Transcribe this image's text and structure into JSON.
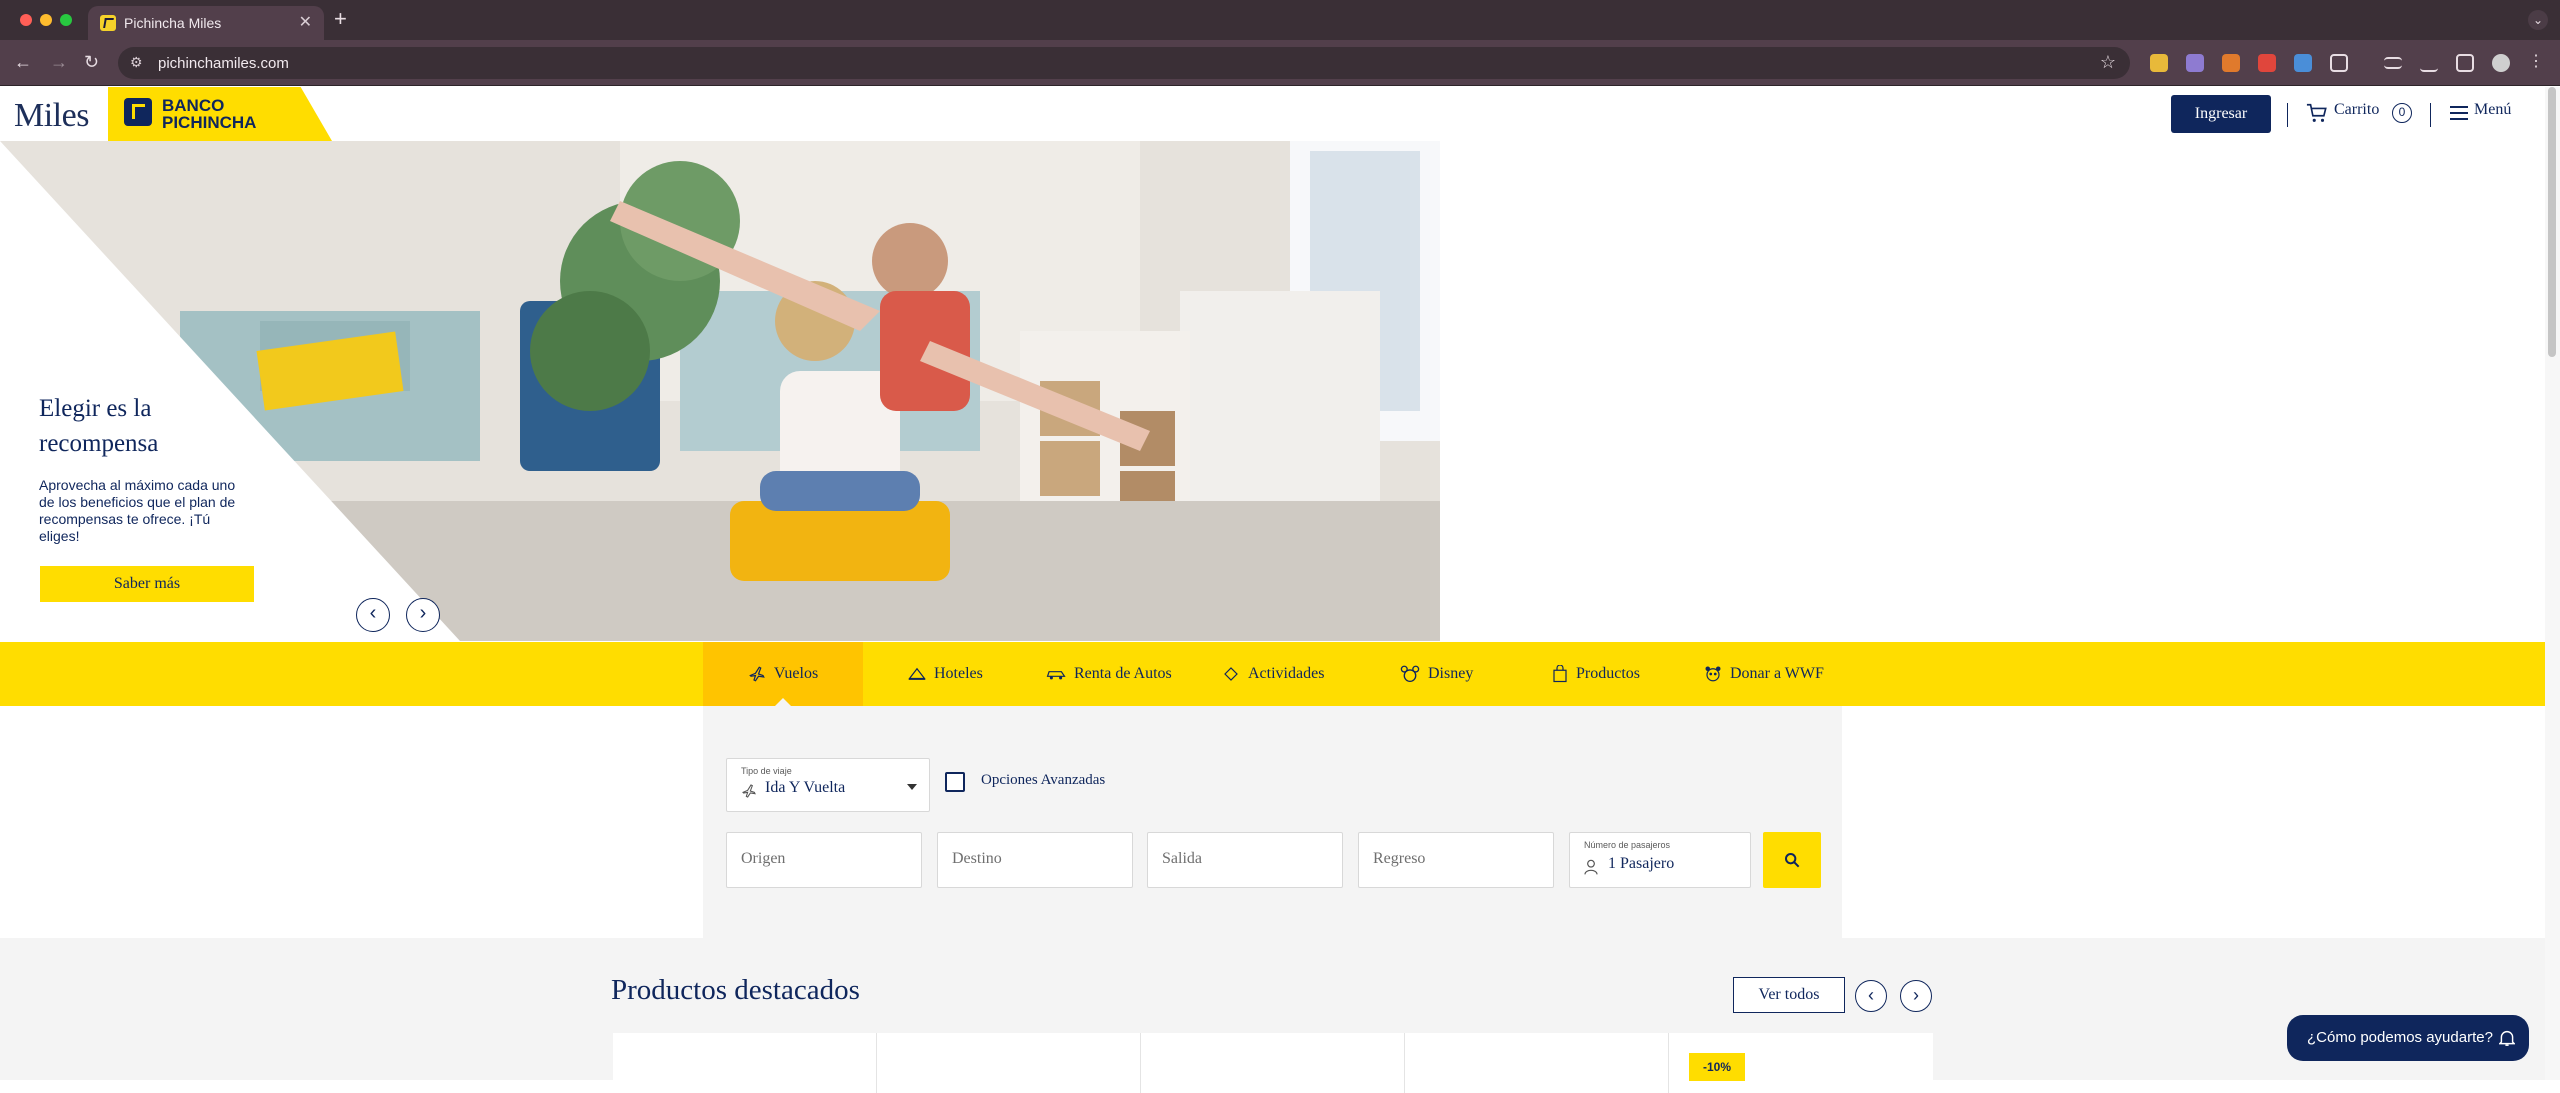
{
  "browser": {
    "tab_title": "Pichincha Miles",
    "url": "pichinchamiles.com"
  },
  "header": {
    "logo_miles": "Miles",
    "logo_bank_line1": "BANCO",
    "logo_bank_line2": "PICHINCHA",
    "login_label": "Ingresar",
    "cart_label": "Carrito",
    "cart_count": "0",
    "menu_label": "Menú"
  },
  "hero": {
    "title": "Elegir es la recompensa",
    "text": "Aprovecha al máximo cada uno de los beneficios que el plan de recompensas te ofrece. ¡Tú eliges!",
    "cta_label": "Saber más"
  },
  "categories": [
    {
      "label": "Vuelos",
      "icon": "plane-icon",
      "active": true
    },
    {
      "label": "Hoteles",
      "icon": "hotel-icon",
      "active": false
    },
    {
      "label": "Renta de Autos",
      "icon": "car-icon",
      "active": false
    },
    {
      "label": "Actividades",
      "icon": "ticket-icon",
      "active": false
    },
    {
      "label": "Disney",
      "icon": "mickey-icon",
      "active": false
    },
    {
      "label": "Productos",
      "icon": "bag-icon",
      "active": false
    },
    {
      "label": "Donar a WWF",
      "icon": "panda-icon",
      "active": false
    }
  ],
  "search": {
    "trip_type_label": "Tipo de viaje",
    "trip_type_value": "Ida Y Vuelta",
    "advanced_label": "Opciones Avanzadas",
    "origin_placeholder": "Origen",
    "destination_placeholder": "Destino",
    "departure_placeholder": "Salida",
    "return_placeholder": "Regreso",
    "passengers_label": "Número de pasajeros",
    "passengers_value": "1 Pasajero"
  },
  "featured": {
    "title": "Productos destacados",
    "see_all_label": "Ver todos",
    "discount_badge": "-10%"
  },
  "help": {
    "label": "¿Cómo podemos ayudarte?"
  },
  "colors": {
    "brand_navy": "#0f265c",
    "brand_yellow": "#ffdd00",
    "active_tab": "#ffc400"
  }
}
